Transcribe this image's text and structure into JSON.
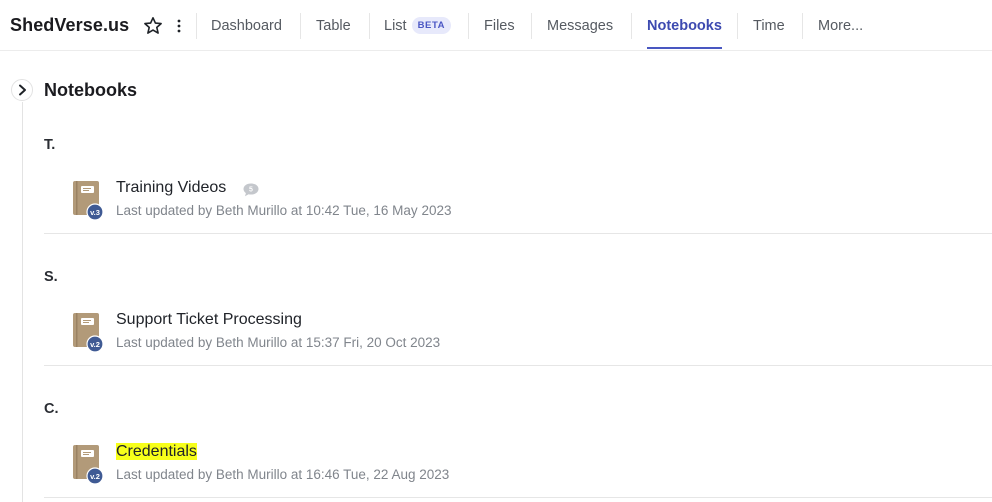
{
  "header": {
    "project_title": "ShedVerse.us",
    "tabs": [
      {
        "label": "Dashboard"
      },
      {
        "label": "Table"
      },
      {
        "label": "List",
        "badge": "BETA"
      },
      {
        "label": "Files"
      },
      {
        "label": "Messages"
      },
      {
        "label": "Notebooks",
        "active": true
      },
      {
        "label": "Time"
      },
      {
        "label": "More..."
      }
    ],
    "icons": {
      "favorite": "star-icon",
      "options": "kebab-icon"
    }
  },
  "main": {
    "section_title": "Notebooks",
    "toggle_icon": "chevron-right-icon",
    "groups": [
      {
        "letter": "T.",
        "notebooks": [
          {
            "name": "Training Videos",
            "version": "v.3",
            "meta": "Last updated by Beth Murillo at 10:42 Tue, 16 May 2023",
            "comment_count": "5",
            "highlight": false
          }
        ]
      },
      {
        "letter": "S.",
        "notebooks": [
          {
            "name": "Support Ticket Processing",
            "version": "v.2",
            "meta": "Last updated by Beth Murillo at 15:37 Fri, 20 Oct 2023",
            "highlight": false
          }
        ]
      },
      {
        "letter": "C.",
        "notebooks": [
          {
            "name": "Credentials",
            "version": "v.2",
            "meta": "Last updated by Beth Murillo at 16:46 Tue, 22 Aug 2023",
            "highlight": true
          }
        ]
      }
    ]
  },
  "colors": {
    "accent": "#4957c1",
    "highlight": "#f7ff1a",
    "notebook_cover": "#b29a79",
    "version_badge": "#3f5a94"
  }
}
